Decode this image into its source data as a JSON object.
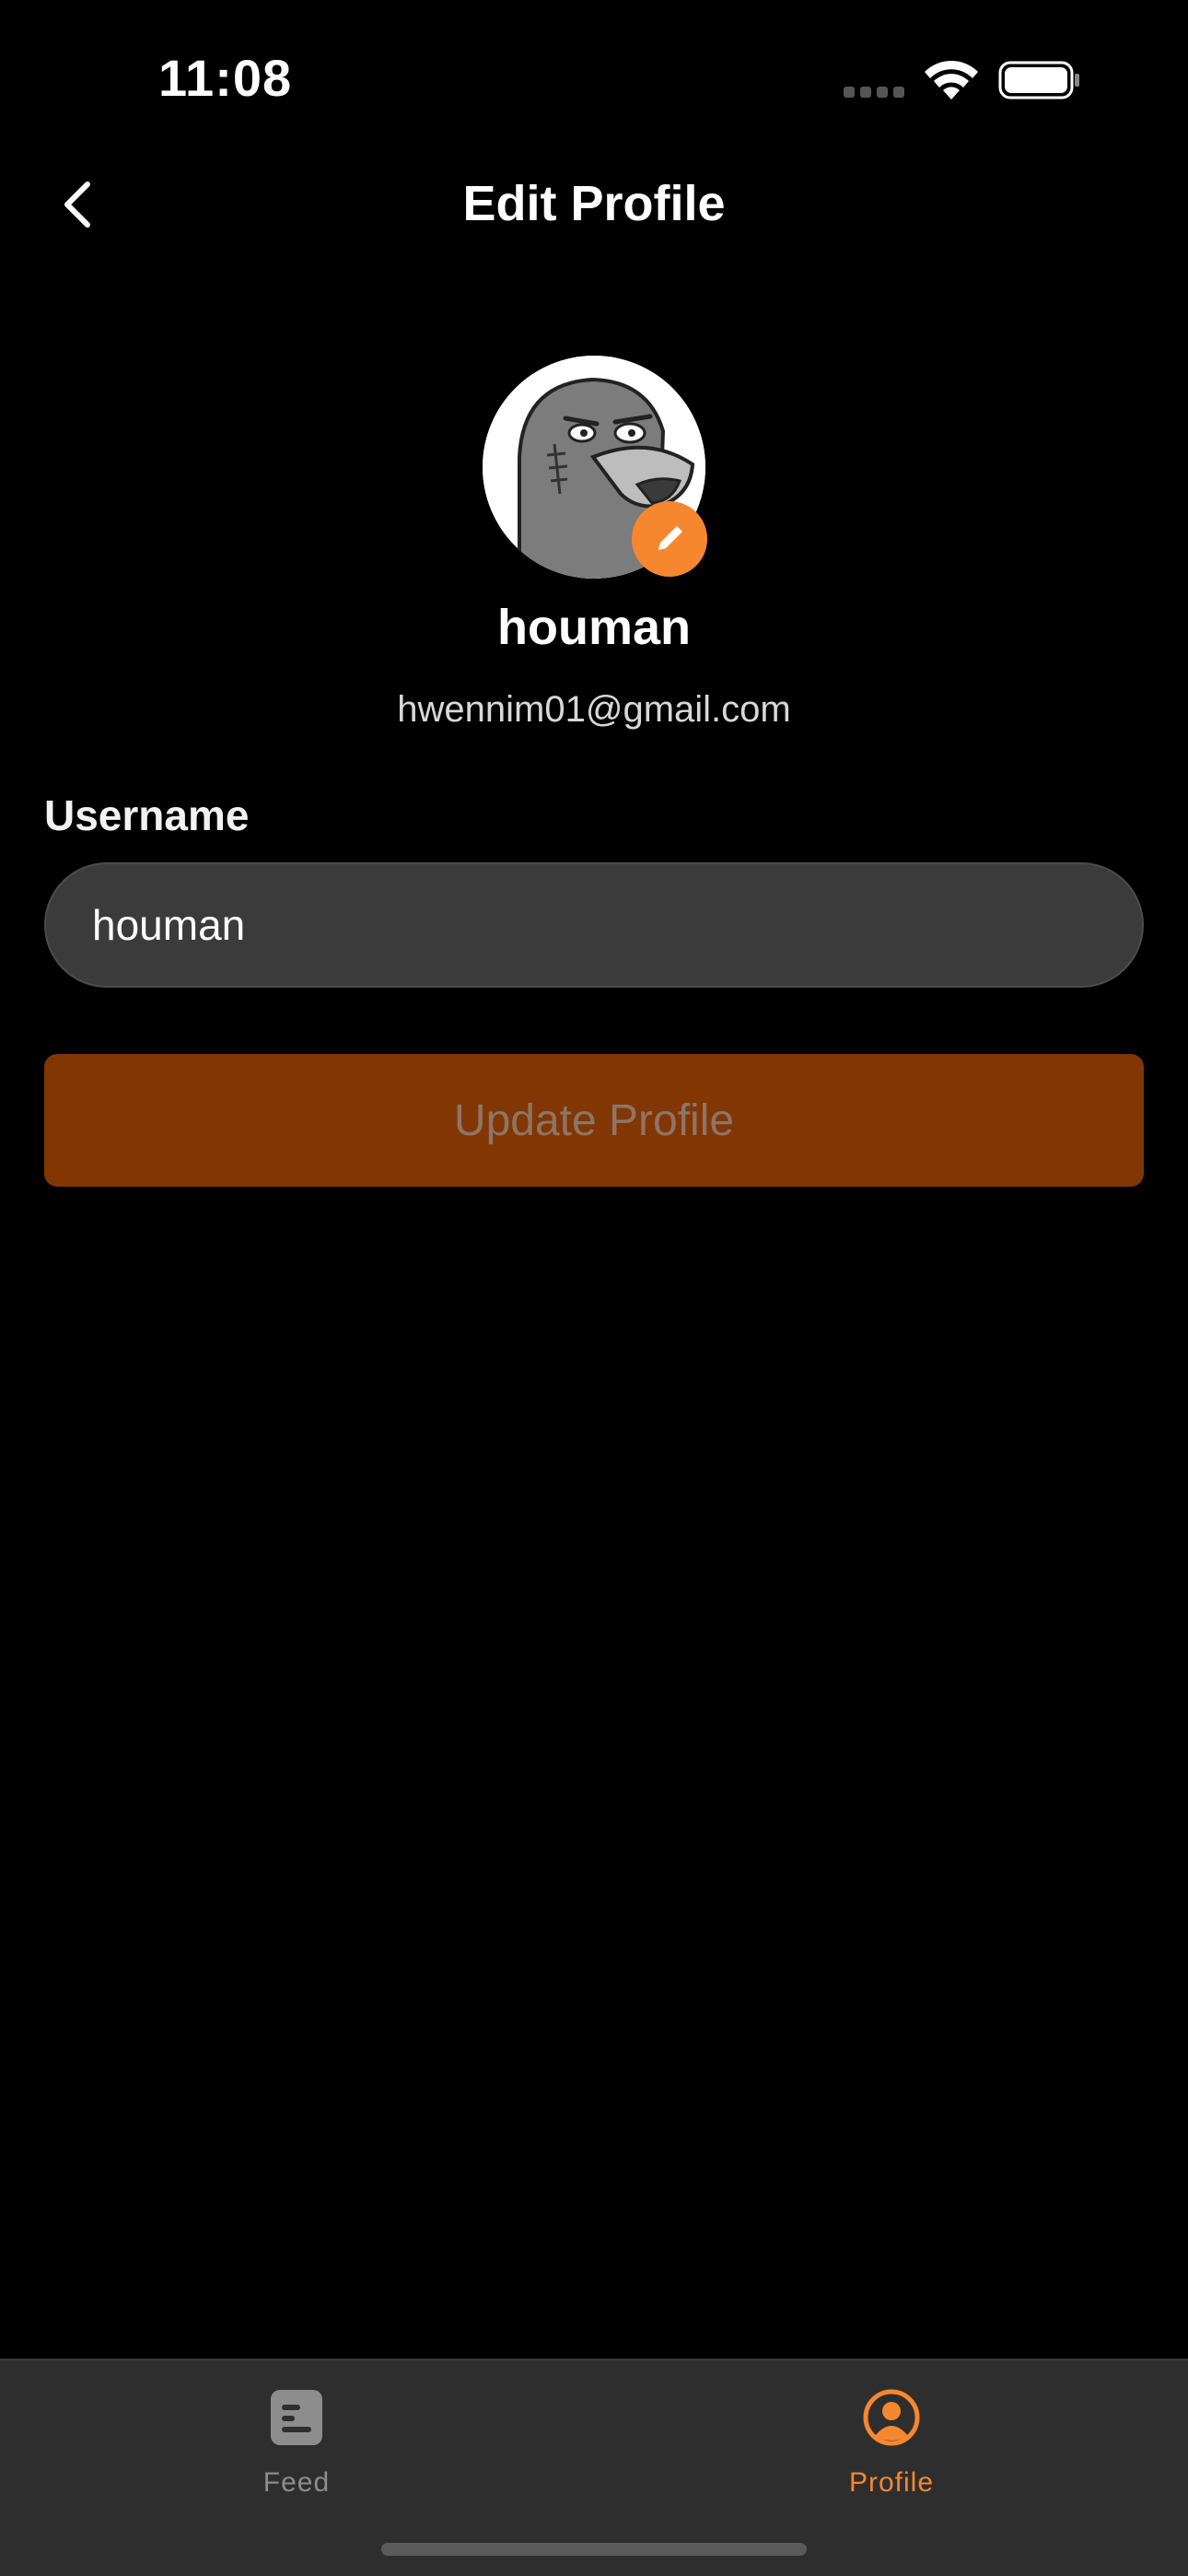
{
  "status_bar": {
    "time": "11:08",
    "icons": [
      "cellular-signal-icon",
      "wifi-icon",
      "battery-icon"
    ]
  },
  "header": {
    "title": "Edit Profile",
    "back_icon": "chevron-left-icon"
  },
  "profile": {
    "display_name": "houman",
    "email": "hwennim01@gmail.com",
    "avatar_icon": "cartoon-pigeon-avatar",
    "edit_icon": "pencil-icon"
  },
  "form": {
    "username_label": "Username",
    "username_value": "houman",
    "submit_label": "Update Profile"
  },
  "tab_bar": {
    "items": [
      {
        "label": "Feed",
        "icon": "document-list-icon",
        "active": false
      },
      {
        "label": "Profile",
        "icon": "user-circle-icon",
        "active": true
      }
    ]
  },
  "colors": {
    "accent": "#f7872f",
    "button_disabled_bg": "#823603",
    "background": "#000000",
    "input_bg": "#3b3b3b",
    "tab_bar_bg": "#2e2e2e"
  }
}
